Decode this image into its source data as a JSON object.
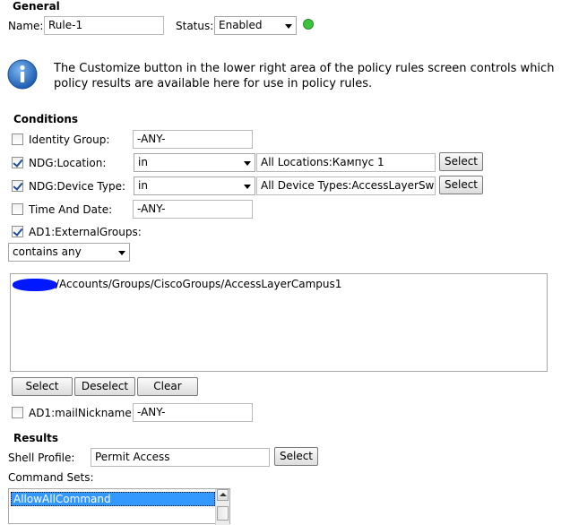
{
  "general": {
    "title": "General",
    "name_label": "Name:",
    "name_value": "Rule-1",
    "status_label": "Status:",
    "status_value": "Enabled",
    "status_color": "#3cc43c"
  },
  "info": {
    "icon": "info-icon",
    "text": "The Customize button in the lower right area of the policy rules screen controls which policy results are available here for use in policy rules."
  },
  "conditions": {
    "title": "Conditions",
    "identity_group": {
      "label": "Identity Group:",
      "checked": false,
      "value": "-ANY-"
    },
    "ndg_location": {
      "label": "NDG:Location:",
      "checked": true,
      "operator": "in",
      "value": "All Locations:Кампус 1",
      "select_label": "Select"
    },
    "ndg_device_type": {
      "label": "NDG:Device Type:",
      "checked": true,
      "operator": "in",
      "value": "All Device Types:AccessLayerSwitch",
      "select_label": "Select"
    },
    "time_and_date": {
      "label": "Time And Date:",
      "checked": false,
      "value": "-ANY-"
    },
    "ad1_external_groups": {
      "label": "AD1:ExternalGroups:",
      "checked": true,
      "operator": "contains any",
      "items": [
        "/Accounts/Groups/CiscoGroups/AccessLayerCampus1"
      ],
      "select_label": "Select",
      "deselect_label": "Deselect",
      "clear_label": "Clear"
    },
    "ad1_mail_nickname": {
      "label": "AD1:mailNickname:",
      "checked": false,
      "value": "-ANY-"
    }
  },
  "results": {
    "title": "Results",
    "shell_profile_label": "Shell Profile:",
    "shell_profile_value": "Permit Access",
    "select_label": "Select",
    "command_sets_label": "Command Sets:",
    "command_sets": [
      "AllowAllCommand"
    ]
  }
}
